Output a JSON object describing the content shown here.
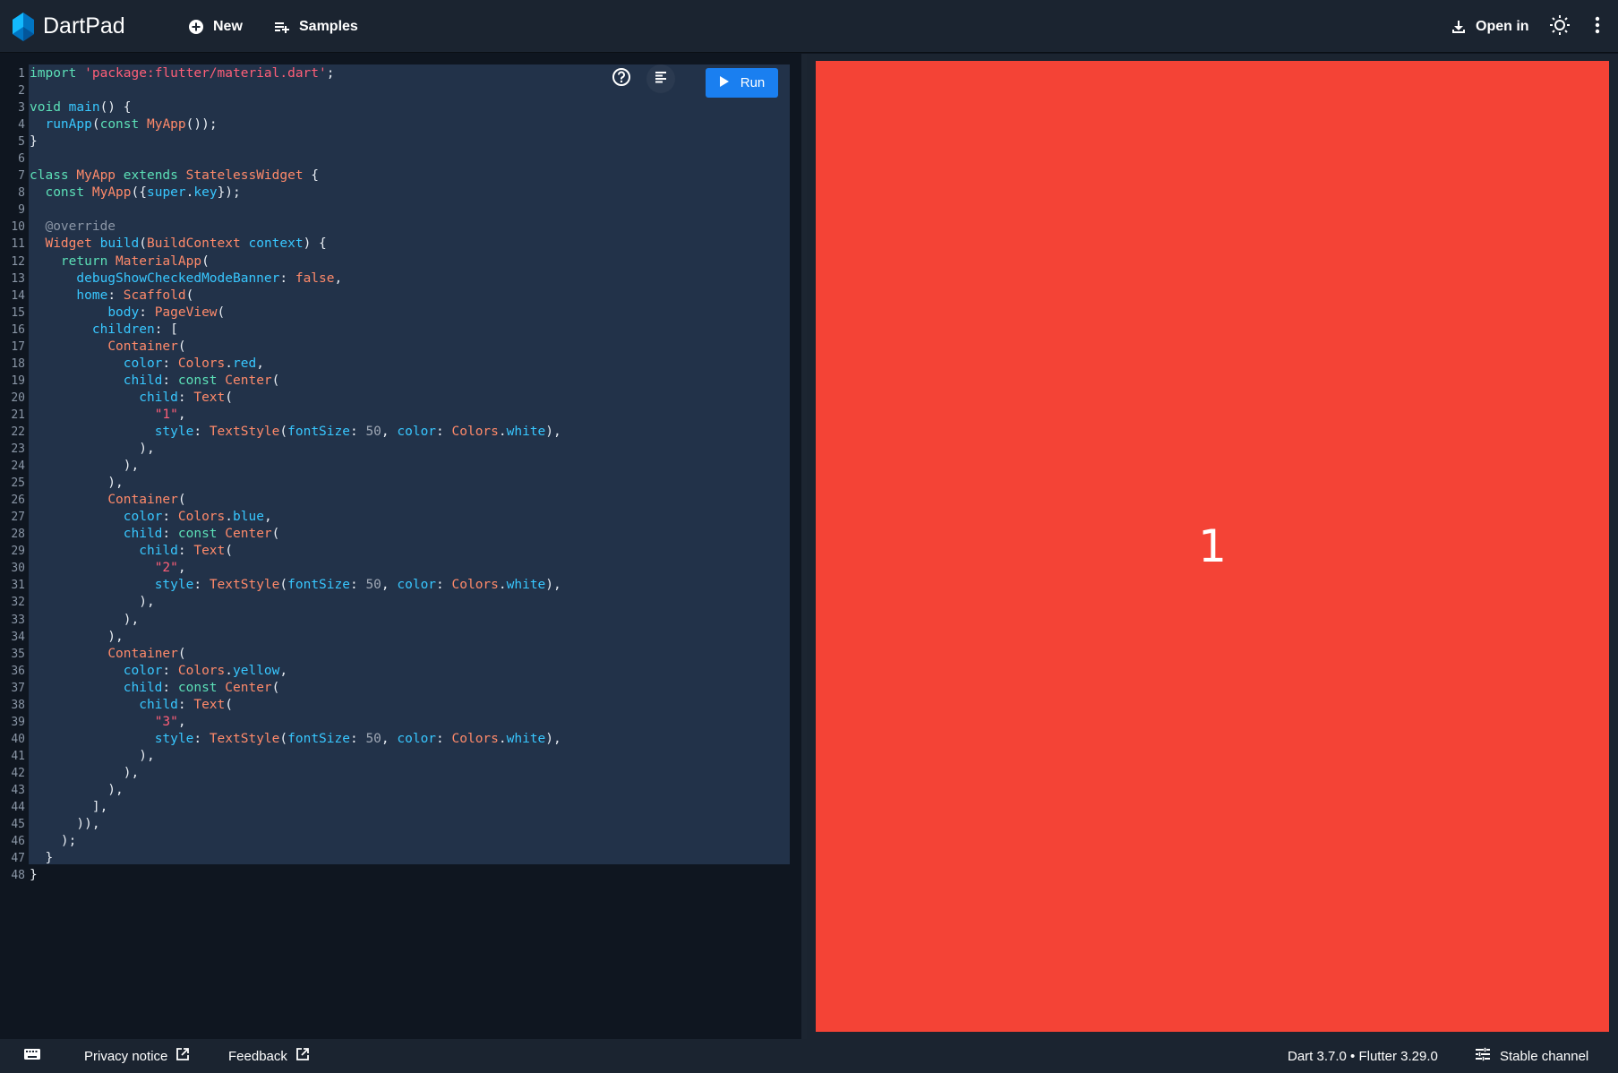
{
  "app": {
    "title": "DartPad"
  },
  "toolbar": {
    "new_label": "New",
    "samples_label": "Samples",
    "open_in_label": "Open in",
    "icons": {
      "new": "add-circle-icon",
      "samples": "playlist-add-icon",
      "open_in": "download-icon",
      "theme": "brightness-icon",
      "more": "more-vert-icon"
    }
  },
  "editor": {
    "run_label": "Run",
    "line_numbers": [
      "1",
      "2",
      "3",
      "4",
      "5",
      "6",
      "7",
      "8",
      "9",
      "10",
      "11",
      "12",
      "13",
      "14",
      "15",
      "16",
      "17",
      "18",
      "19",
      "20",
      "21",
      "22",
      "23",
      "24",
      "25",
      "26",
      "27",
      "28",
      "29",
      "30",
      "31",
      "32",
      "33",
      "34",
      "35",
      "36",
      "37",
      "38",
      "39",
      "40",
      "41",
      "42",
      "43",
      "44",
      "45",
      "46",
      "47",
      "48"
    ],
    "lines": [
      "import 'package:flutter/material.dart';",
      "",
      "void main() {",
      "  runApp(const MyApp());",
      "}",
      "",
      "class MyApp extends StatelessWidget {",
      "  const MyApp({super.key});",
      "",
      "  @override",
      "  Widget build(BuildContext context) {",
      "    return MaterialApp(",
      "      debugShowCheckedModeBanner: false,",
      "      home: Scaffold(",
      "          body: PageView(",
      "        children: [",
      "          Container(",
      "            color: Colors.red,",
      "            child: const Center(",
      "              child: Text(",
      "                \"1\",",
      "                style: TextStyle(fontSize: 50, color: Colors.white),",
      "              ),",
      "            ),",
      "          ),",
      "          Container(",
      "            color: Colors.blue,",
      "            child: const Center(",
      "              child: Text(",
      "                \"2\",",
      "                style: TextStyle(fontSize: 50, color: Colors.white),",
      "              ),",
      "            ),",
      "          ),",
      "          Container(",
      "            color: Colors.yellow,",
      "            child: const Center(",
      "              child: Text(",
      "                \"3\",",
      "                style: TextStyle(fontSize: 50, color: Colors.white),",
      "              ),",
      "            ),",
      "          ),",
      "        ],",
      "      )),",
      "    );",
      "  }",
      "}"
    ]
  },
  "preview": {
    "text": "1",
    "background": "#f44336"
  },
  "footer": {
    "privacy_label": "Privacy notice",
    "feedback_label": "Feedback",
    "version_label": "Dart 3.7.0 • Flutter 3.29.0",
    "channel_label": "Stable channel"
  },
  "colors": {
    "accent": "#1a7ff0",
    "topbar": "#1b2430",
    "editor_bg": "#0f1620",
    "highlight": "#223249"
  }
}
